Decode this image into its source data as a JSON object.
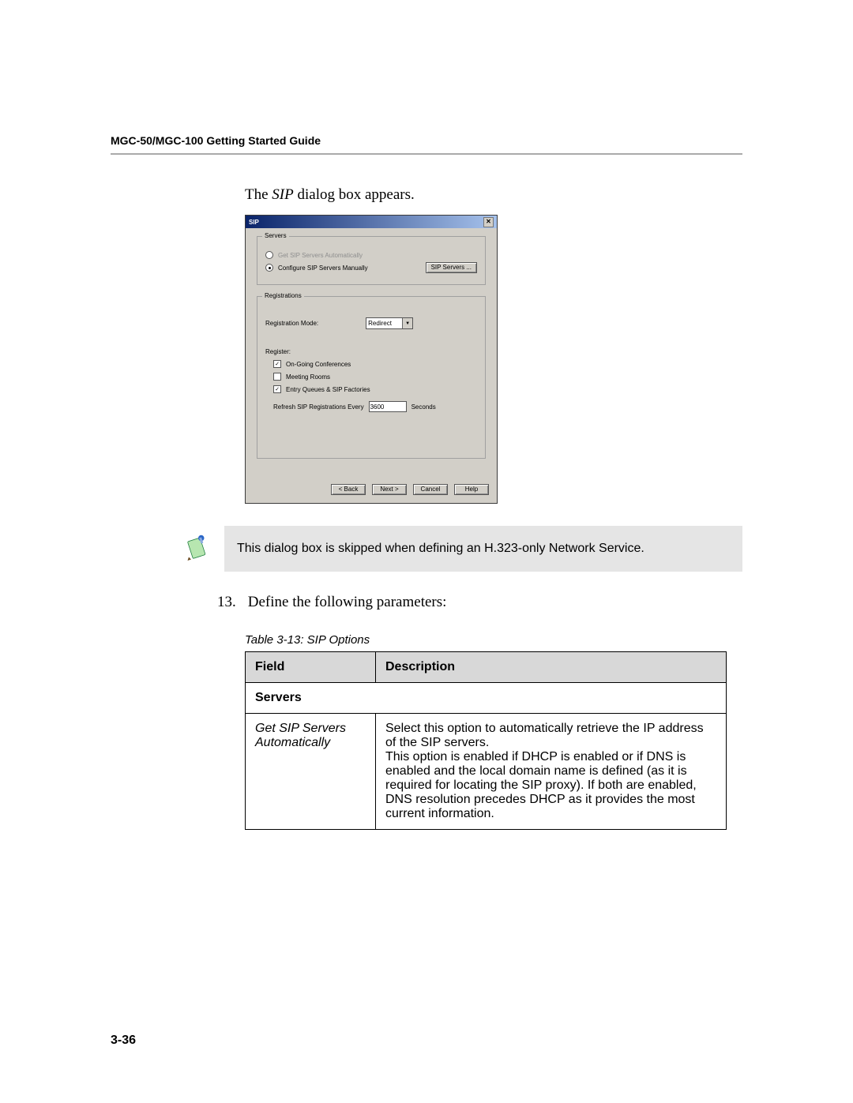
{
  "header": "MGC-50/MGC-100 Getting Started Guide",
  "intro": {
    "prefix": "The ",
    "italic": "SIP",
    "suffix": " dialog box appears."
  },
  "dialog": {
    "title": "SIP",
    "close_symbol": "✕",
    "servers": {
      "legend": "Servers",
      "opt_auto": "Get SIP Servers Automatically",
      "opt_manual": "Configure SIP Servers Manually",
      "btn_sip_servers": "SIP Servers ..."
    },
    "registrations": {
      "legend": "Registrations",
      "mode_label": "Registration Mode:",
      "mode_value": "Redirect",
      "register_label": "Register:",
      "chk_ongoing": "On-Going Conferences",
      "chk_meeting": "Meeting Rooms",
      "chk_entry": "Entry Queues & SIP Factories",
      "refresh_label": "Refresh SIP Registrations Every",
      "refresh_value": "3600",
      "refresh_unit": "Seconds"
    },
    "buttons": {
      "back": "< Back",
      "next": "Next >",
      "cancel": "Cancel",
      "help": "Help"
    }
  },
  "note_text": "This dialog box is skipped when defining an H.323-only Network Service.",
  "step": {
    "num": "13.",
    "text": "Define the following parameters:"
  },
  "table": {
    "caption": "Table 3-13: SIP Options",
    "head_field": "Field",
    "head_desc": "Description",
    "section": "Servers",
    "row1_field": "Get SIP Servers Automatically",
    "row1_desc": "Select this option to automatically retrieve the IP address of the SIP servers.\nThis option is enabled if DHCP is enabled or if DNS is enabled and the local domain name is defined (as it is required for locating the SIP proxy). If both are enabled, DNS resolution precedes DHCP as it provides the most current information."
  },
  "page_number": "3-36"
}
